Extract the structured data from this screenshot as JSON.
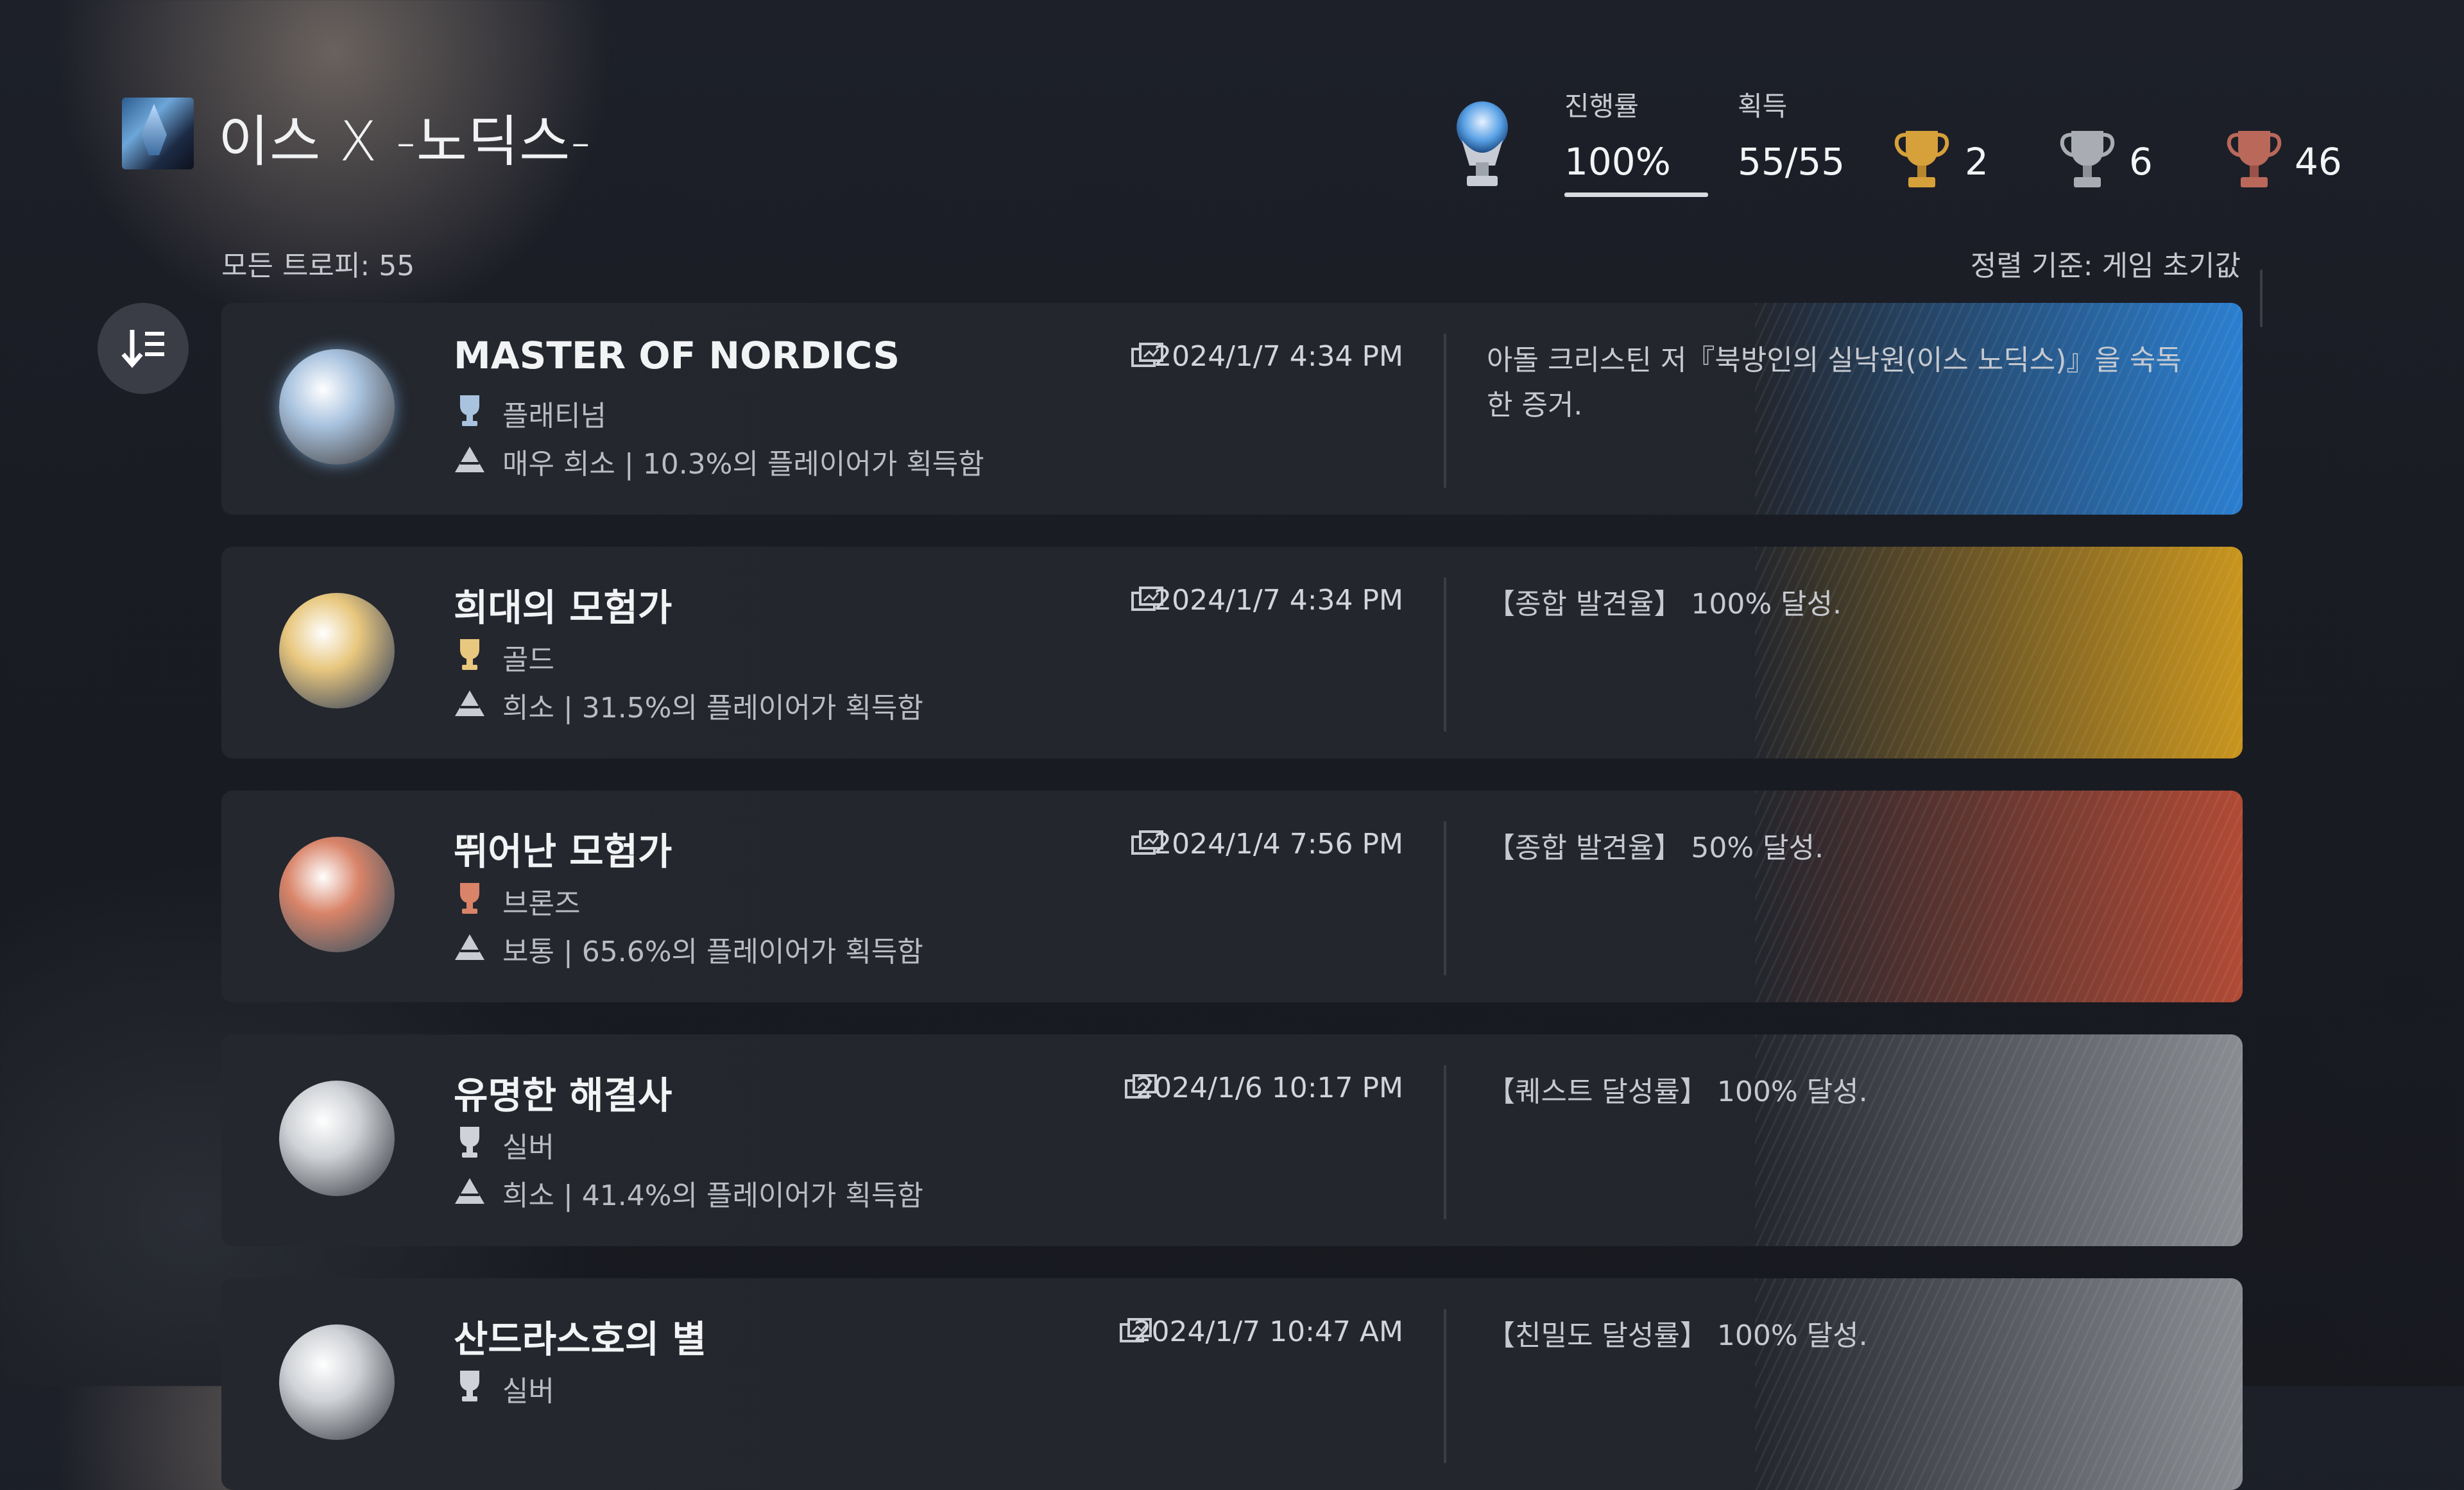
{
  "header": {
    "game_title": "이스 X -노딕스-",
    "progress_label": "진행률",
    "progress_value": "100%",
    "progress_fraction": 1.0,
    "earned_label": "획득",
    "earned_value": "55/55",
    "gold_count": "2",
    "silver_count": "6",
    "bronze_count": "46"
  },
  "list_header": {
    "all_trophies": "모든 트로피: 55",
    "sort_by": "정렬 기준: 게임 초기값"
  },
  "trophies": [
    {
      "name": "MASTER OF NORDICS",
      "type": "플래티넘",
      "rarity": "매우 희소 | 10.3%의 플레이어가 획득함",
      "date": "2024/1/7  4:34 PM",
      "description": "아돌 크리스틴 저『북방인의 실낙원(이스 노딕스)』을 숙독한 증거.",
      "accent": "#2b7fd0",
      "medal_color": "#a9c3df",
      "icon": "platinum-trophy-icon"
    },
    {
      "name": "희대의 모험가",
      "type": "골드",
      "rarity": "희소 | 31.5%의 플레이어가 획득함",
      "date": "2024/1/7  4:34 PM",
      "description": "【종합 발견율】 100% 달성.",
      "accent": "#c9951e",
      "medal_color": "#e8c77e",
      "icon": "gold-trophy-icon"
    },
    {
      "name": "뛰어난 모험가",
      "type": "브론즈",
      "rarity": "보통 | 65.6%의 플레이어가 획득함",
      "date": "2024/1/4  7:56 PM",
      "description": "【종합 발견율】 50% 달성.",
      "accent": "#b04a35",
      "medal_color": "#d98469",
      "icon": "bronze-trophy-icon"
    },
    {
      "name": "유명한 해결사",
      "type": "실버",
      "rarity": "희소 | 41.4%의 플레이어가 획득함",
      "date": "2024/1/6  10:17 PM",
      "description": "【퀘스트 달성률】 100% 달성.",
      "accent": "#8a8d92",
      "medal_color": "#cfd2d6",
      "icon": "silver-trophy-icon"
    },
    {
      "name": "산드라스호의 별",
      "type": "실버",
      "rarity": "",
      "date": "2024/1/7  10:47 AM",
      "description": "【친밀도 달성률】 100% 달성.",
      "accent": "#8a8d92",
      "medal_color": "#cfd2d6",
      "icon": "silver-trophy-icon"
    }
  ]
}
